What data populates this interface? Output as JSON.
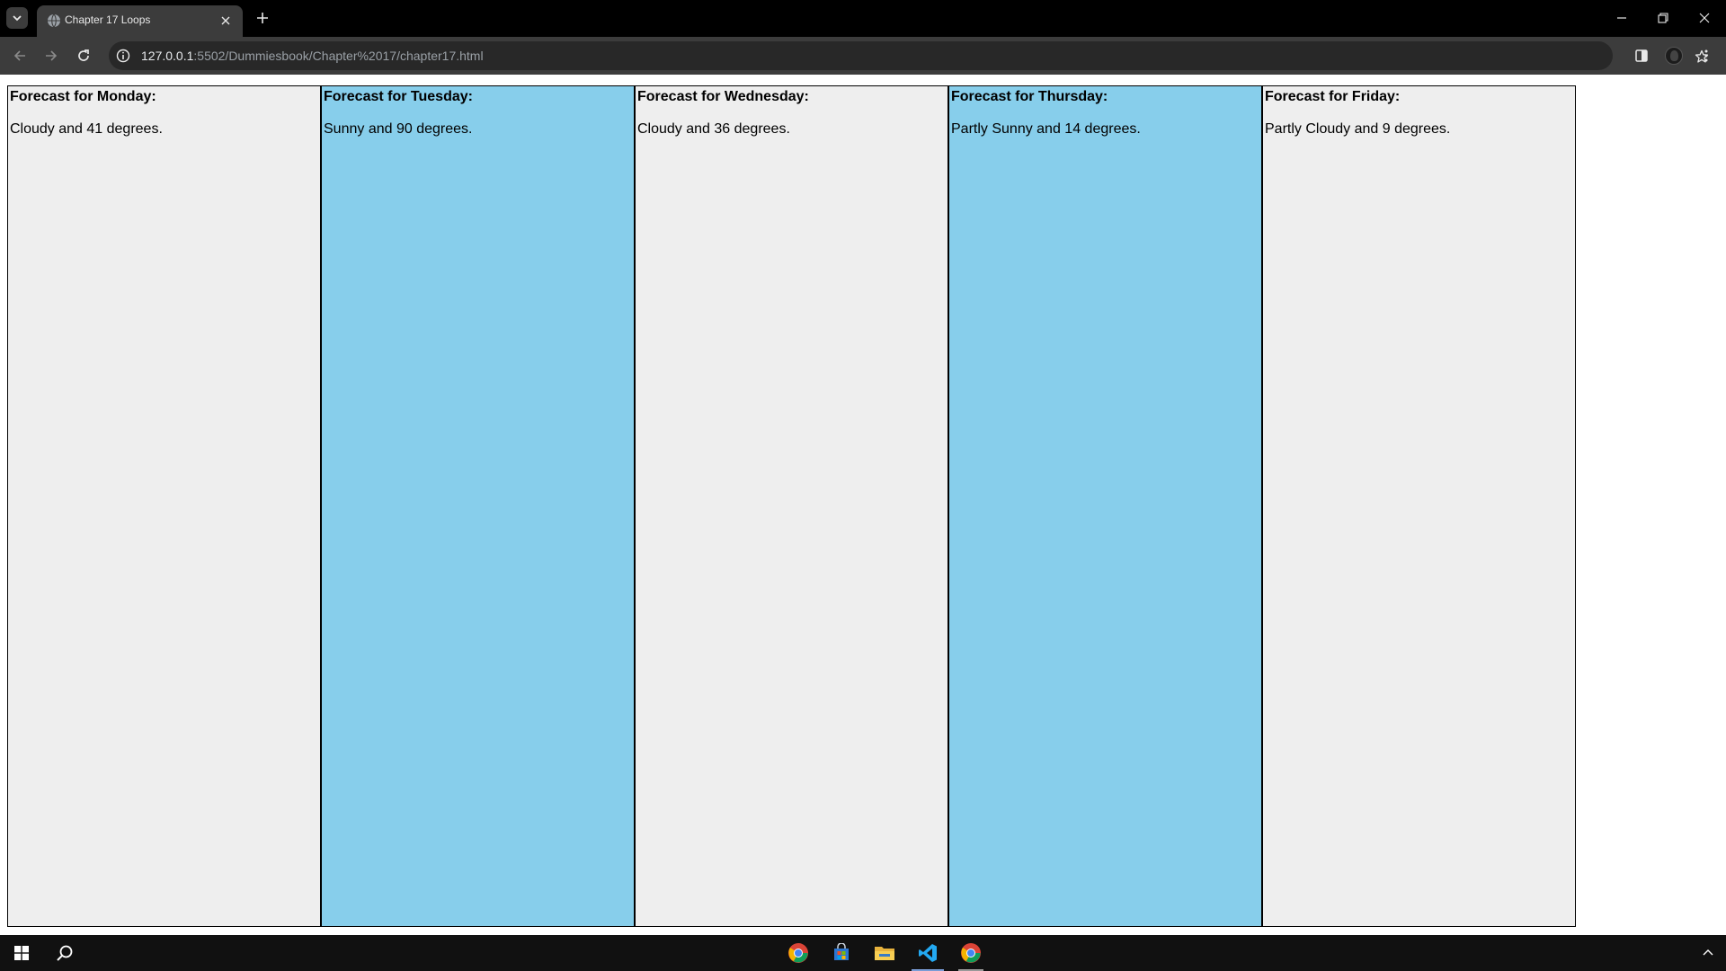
{
  "browser": {
    "tab": {
      "title": "Chapter 17 Loops"
    },
    "url": {
      "host": "127.0.0.1",
      "path": ":5502/Dummiesbook/Chapter%2017/chapter17.html"
    }
  },
  "page": {
    "days": [
      {
        "heading": "Forecast for Monday:",
        "text": "Cloudy and 41 degrees.",
        "bg": "#eeeeee"
      },
      {
        "heading": "Forecast for Tuesday:",
        "text": "Sunny and 90 degrees.",
        "bg": "#87ceeb"
      },
      {
        "heading": "Forecast for Wednesday:",
        "text": "Cloudy and 36 degrees.",
        "bg": "#eeeeee"
      },
      {
        "heading": "Forecast for Thursday:",
        "text": "Partly Sunny and 14 degrees.",
        "bg": "#87ceeb"
      },
      {
        "heading": "Forecast for Friday:",
        "text": "Partly Cloudy and 9 degrees.",
        "bg": "#eeeeee"
      }
    ]
  },
  "icons": {
    "tab_search": "chevron-down-icon",
    "favicon": "globe-icon",
    "tab_close": "close-icon",
    "new_tab": "plus-icon",
    "minimize": "minimize-icon",
    "restore": "restore-icon",
    "close_window": "close-icon",
    "back": "back-arrow-icon",
    "forward": "forward-arrow-icon",
    "reload": "reload-icon",
    "site_info": "info-icon",
    "bookmark": "star-icon",
    "side_panel": "side-panel-icon",
    "profile": "avatar",
    "menu": "kebab-menu-icon",
    "taskbar": [
      "windows-start-icon",
      "search-icon",
      "chrome-icon",
      "store-icon",
      "file-explorer-icon",
      "vscode-icon",
      "chrome-icon"
    ]
  }
}
